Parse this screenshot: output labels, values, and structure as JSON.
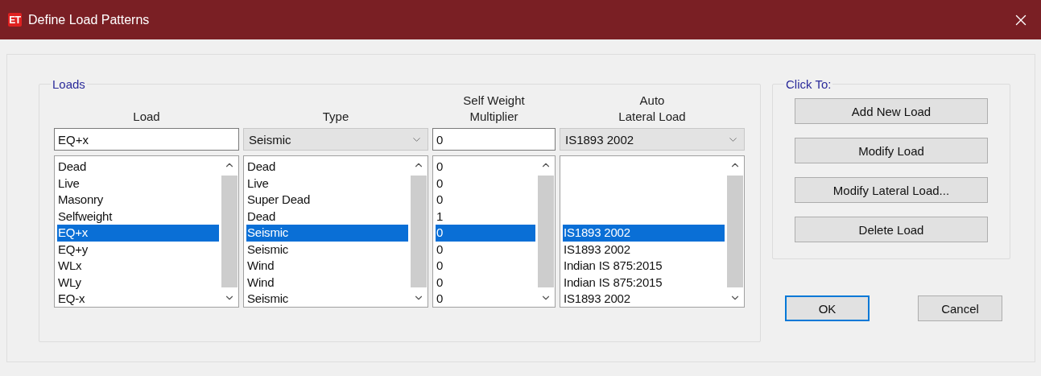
{
  "window": {
    "icon_text": "ET",
    "title": "Define Load Patterns"
  },
  "loads": {
    "legend": "Loads",
    "columns": [
      {
        "header": "Load",
        "editor": {
          "kind": "text",
          "value": "EQ+x"
        }
      },
      {
        "header": "Type",
        "editor": {
          "kind": "combo",
          "value": "Seismic"
        }
      },
      {
        "header": "Self Weight\nMultiplier",
        "editor": {
          "kind": "text",
          "value": "0"
        }
      },
      {
        "header": "Auto\nLateral Load",
        "editor": {
          "kind": "combo",
          "value": "IS1893 2002"
        }
      }
    ],
    "rows": [
      {
        "cells": [
          "Dead",
          "Dead",
          "0"
        ],
        "selected": false
      },
      {
        "cells": [
          "Live",
          "Live",
          "0"
        ],
        "selected": false
      },
      {
        "cells": [
          "Masonry",
          "Super Dead",
          "0"
        ],
        "selected": false
      },
      {
        "cells": [
          "Selfweight",
          "Dead",
          "1"
        ],
        "selected": false
      },
      {
        "cells": [
          "EQ+x",
          "Seismic",
          "0",
          "IS1893 2002"
        ],
        "selected": true
      },
      {
        "cells": [
          "EQ+y",
          "Seismic",
          "0",
          "IS1893 2002"
        ],
        "selected": false
      },
      {
        "cells": [
          "WLx",
          "Wind",
          "0",
          "Indian IS 875:2015"
        ],
        "selected": false
      },
      {
        "cells": [
          "WLy",
          "Wind",
          "0",
          "Indian IS 875:2015"
        ],
        "selected": false
      },
      {
        "cells": [
          "EQ-x",
          "Seismic",
          "0",
          "IS1893 2002"
        ],
        "selected": false
      }
    ]
  },
  "click_to": {
    "legend": "Click To:",
    "buttons": [
      "Add New Load",
      "Modify Load",
      "Modify Lateral Load...",
      "Delete Load"
    ]
  },
  "dialog_buttons": [
    {
      "label": "OK",
      "default": true
    },
    {
      "label": "Cancel",
      "default": false
    }
  ]
}
